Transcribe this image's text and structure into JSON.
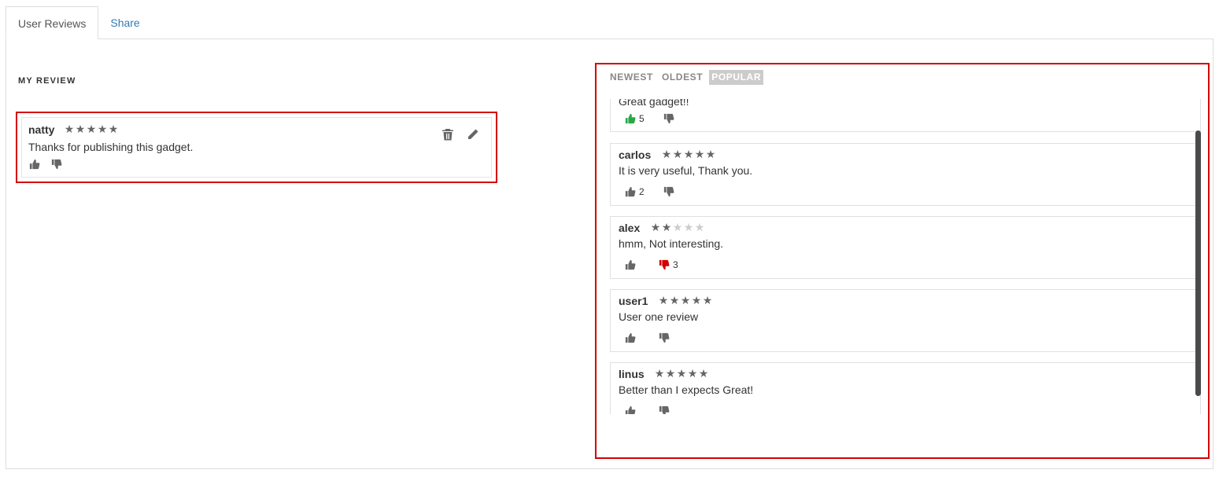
{
  "tabs": [
    {
      "label": "User Reviews",
      "active": true
    },
    {
      "label": "Share",
      "active": false
    }
  ],
  "my_review": {
    "title": "MY REVIEW",
    "user": "natty",
    "rating": 5,
    "text": "Thanks for publishing this gadget.",
    "actions": {
      "delete_icon": "trash-icon",
      "edit_icon": "pencil-icon"
    }
  },
  "sort": {
    "options": [
      "NEWEST",
      "OLDEST",
      "POPULAR"
    ],
    "active": "POPULAR"
  },
  "reviews": [
    {
      "user": "",
      "rating": 0,
      "text": "Great gadget!!",
      "likes": "5",
      "dislikes": "",
      "liked": true,
      "disliked": false
    },
    {
      "user": "carlos",
      "rating": 5,
      "text": "It is very useful, Thank you.",
      "likes": "2",
      "dislikes": "",
      "liked": false,
      "disliked": false
    },
    {
      "user": "alex",
      "rating": 2,
      "text": "hmm, Not interesting.",
      "likes": "",
      "dislikes": "3",
      "liked": false,
      "disliked": true
    },
    {
      "user": "user1",
      "rating": 5,
      "text": "User one review",
      "likes": "",
      "dislikes": "",
      "liked": false,
      "disliked": false
    },
    {
      "user": "linus",
      "rating": 5,
      "text": "Better than I expects Great!",
      "likes": "",
      "dislikes": "",
      "liked": false,
      "disliked": false
    }
  ],
  "colors": {
    "highlight_border": "#d40000",
    "liked": "#28a745",
    "disliked": "#d40000",
    "icon_default": "#666666",
    "link": "#337ab7"
  }
}
